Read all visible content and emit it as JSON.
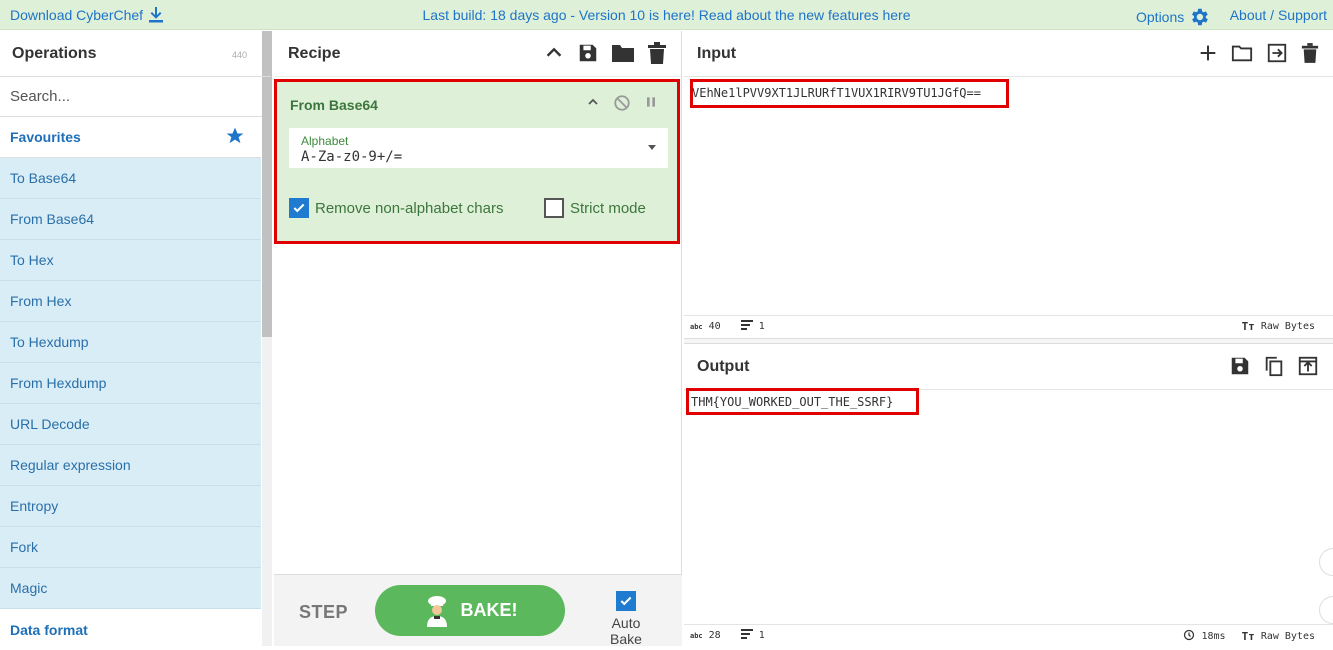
{
  "topbar": {
    "download_label": "Download CyberChef",
    "notice": "Last build: 18 days ago - Version 10 is here! Read about the new features here",
    "options_label": "Options",
    "about_label": "About / Support"
  },
  "operations": {
    "title": "Operations",
    "count": "440",
    "search_placeholder": "Search...",
    "favourites_label": "Favourites",
    "items": [
      "To Base64",
      "From Base64",
      "To Hex",
      "From Hex",
      "To Hexdump",
      "From Hexdump",
      "URL Decode",
      "Regular expression",
      "Entropy",
      "Fork",
      "Magic"
    ],
    "next_category": "Data format"
  },
  "recipe": {
    "title": "Recipe",
    "operation": {
      "name": "From Base64",
      "alphabet_label": "Alphabet",
      "alphabet_value": "A-Za-z0-9+/=",
      "remove_nonalpha_label": "Remove non-alphabet chars",
      "remove_nonalpha_checked": true,
      "strict_mode_label": "Strict mode",
      "strict_mode_checked": false
    },
    "step_label": "STEP",
    "bake_label": "BAKE!",
    "autobake_label": "Auto Bake",
    "autobake_checked": true
  },
  "input": {
    "title": "Input",
    "text": "VEhNe1lPVV9XT1JLRURfT1VUX1RIRV9TU1JGfQ==",
    "status_chars": "40",
    "status_lines": "1",
    "status_format": "Raw Bytes"
  },
  "output": {
    "title": "Output",
    "text": "THM{YOU_WORKED_OUT_THE_SSRF}",
    "status_chars": "28",
    "status_lines": "1",
    "status_time": "18ms",
    "status_format": "Raw Bytes"
  },
  "colors": {
    "accent": "#1e74c8",
    "highlight": "#e00000",
    "recipe_bg": "#dff0d8",
    "bake_green": "#5cb85c"
  }
}
